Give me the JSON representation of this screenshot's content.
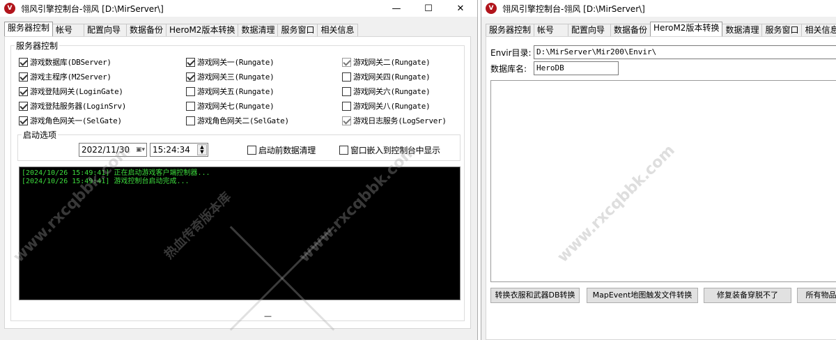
{
  "left_window": {
    "title": "翎风引擎控制台-翎风 [D:\\MirServer\\]",
    "controls": {
      "minimize": "—",
      "maximize": "☐",
      "close": "✕"
    },
    "tabs": [
      "服务器控制",
      "帐号",
      "配置向导",
      "数据备份",
      "HeroM2版本转换",
      "数据清理",
      "服务窗口",
      "相关信息"
    ],
    "group_title": "服务器控制",
    "checkboxes": [
      {
        "label": "游戏数据库(DBServer)",
        "checked": true
      },
      {
        "label": "游戏网关一(Rungate)",
        "checked": true
      },
      {
        "label": "游戏网关二(Rungate)",
        "checked": true
      },
      {
        "label": "游戏主程序(M2Server)",
        "checked": true
      },
      {
        "label": "游戏网关三(Rungate)",
        "checked": true
      },
      {
        "label": "游戏网关四(Rungate)",
        "checked": false
      },
      {
        "label": "游戏登陆网关(LoginGate)",
        "checked": true
      },
      {
        "label": "游戏网关五(Rungate)",
        "checked": false
      },
      {
        "label": "游戏网关六(Rungate)",
        "checked": false
      },
      {
        "label": "游戏登陆服务器(LoginSrv)",
        "checked": true
      },
      {
        "label": "游戏网关七(Rungate)",
        "checked": false
      },
      {
        "label": "游戏网关八(Rungate)",
        "checked": false
      },
      {
        "label": "游戏角色网关一(SelGate)",
        "checked": true
      },
      {
        "label": "游戏角色网关二(SelGate)",
        "checked": false
      },
      {
        "label": "游戏日志服务(LogServer)",
        "checked": true
      }
    ],
    "startup_group": "启动选项",
    "date_value": "2022/11/30",
    "time_value": "15:24:34",
    "clear_before_start": {
      "label": "启动前数据清理",
      "checked": false
    },
    "embed_window": {
      "label": "窗口嵌入到控制台中显示",
      "checked": false
    },
    "log_lines": [
      "[2024/10/26 15:49:41] 正在启动游戏客户端控制器...",
      "[2024/10/26 15:49:41] 游戏控制台启动完成..."
    ],
    "footer_mark": "—"
  },
  "right_window": {
    "title": "翎风引擎控制台-翎风 [D:\\MirServer\\]",
    "tabs": [
      "服务器控制",
      "帐号",
      "配置向导",
      "数据备份",
      "HeroM2版本转换",
      "数据清理",
      "服务窗口",
      "相关信息"
    ],
    "envir_label": "Envir目录:",
    "envir_value": "D:\\MirServer\\Mir200\\Envir\\",
    "db_label": "数据库名:",
    "db_value": "HeroDB",
    "buttons": [
      "转换衣服和武器DB转换",
      "MapEvent地图触发文件转换",
      "修复装备穿脱不了",
      "所有物品名"
    ]
  },
  "watermarks": [
    "www.rxcqbbk.com",
    "热血传奇版本库",
    "www.rxcqbbk.com",
    "www.rxcqbbk.com"
  ]
}
